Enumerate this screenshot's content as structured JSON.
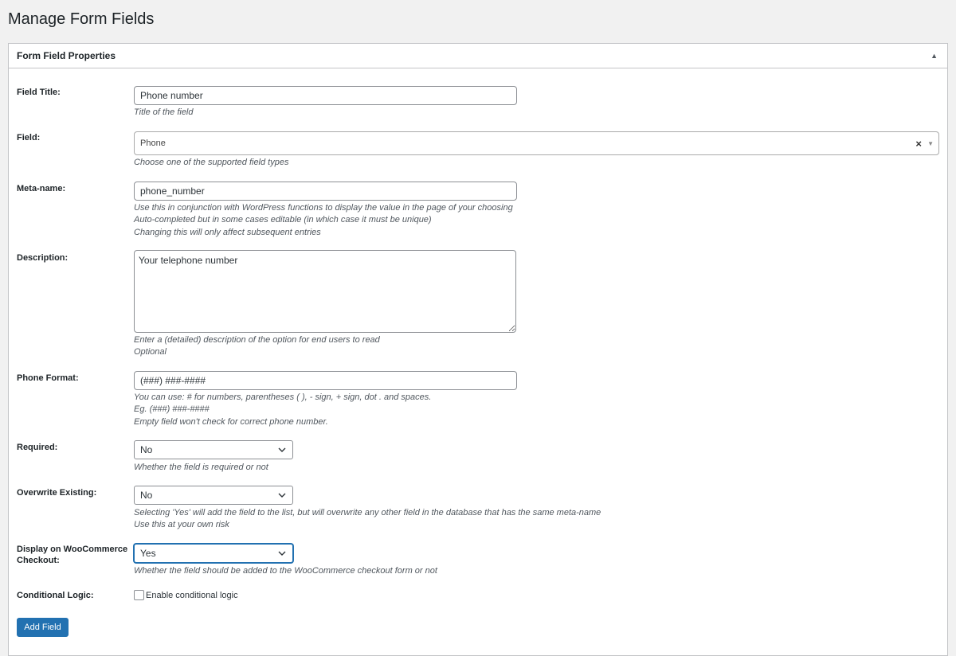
{
  "page": {
    "title": "Manage Form Fields"
  },
  "panel": {
    "title": "Form Field Properties"
  },
  "fields": {
    "field_title": {
      "label": "Field Title:",
      "value": "Phone number",
      "desc": [
        "Title of the field"
      ]
    },
    "field_type": {
      "label": "Field:",
      "value": "Phone",
      "clear": "×",
      "desc": [
        "Choose one of the supported field types"
      ]
    },
    "meta_name": {
      "label": "Meta-name:",
      "value": "phone_number",
      "desc": [
        "Use this in conjunction with WordPress functions to display the value in the page of your choosing",
        "Auto-completed but in some cases editable (in which case it must be unique)",
        "Changing this will only affect subsequent entries"
      ]
    },
    "description": {
      "label": "Description:",
      "value": "Your telephone number",
      "desc": [
        "Enter a (detailed) description of the option for end users to read",
        "Optional"
      ]
    },
    "phone_format": {
      "label": "Phone Format:",
      "value": "(###) ###-####",
      "desc": [
        "You can use: # for numbers, parentheses ( ), - sign, + sign, dot . and spaces.",
        "Eg. (###) ###-####",
        "Empty field won't check for correct phone number."
      ]
    },
    "required": {
      "label": "Required:",
      "value": "No",
      "desc": [
        "Whether the field is required or not"
      ]
    },
    "overwrite": {
      "label": "Overwrite Existing:",
      "value": "No",
      "desc": [
        "Selecting 'Yes' will add the field to the list, but will overwrite any other field in the database that has the same meta-name",
        "Use this at your own risk"
      ]
    },
    "woocommerce": {
      "label_line1": "Display on WooCommerce",
      "label_line2": "Checkout:",
      "value": "Yes",
      "desc": [
        "Whether the field should be added to the WooCommerce checkout form or not"
      ]
    },
    "conditional": {
      "label": "Conditional Logic:",
      "checkbox_label": "Enable conditional logic",
      "checked": false
    }
  },
  "actions": {
    "add_field_label": "Add Field"
  },
  "colors": {
    "primary": "#2271b1",
    "border": "#c3c4c7",
    "background": "#f1f1f1"
  }
}
